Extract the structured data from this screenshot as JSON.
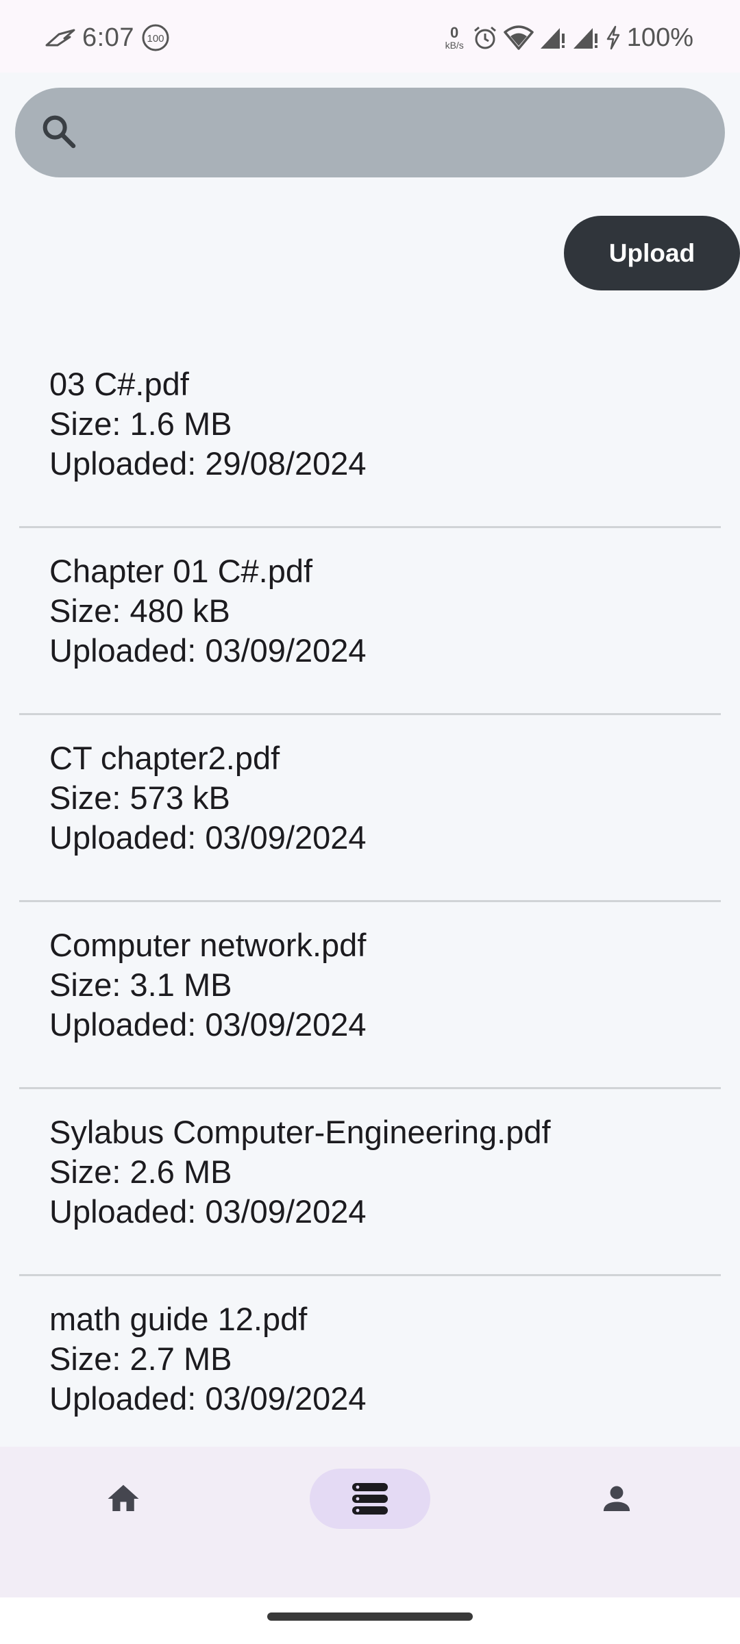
{
  "status_bar": {
    "time": "6:07",
    "speed_value": "0",
    "speed_unit": "kB/s",
    "battery": "100%",
    "notification_badge": "100"
  },
  "search": {
    "placeholder": "",
    "value": ""
  },
  "actions": {
    "upload_label": "Upload"
  },
  "files": [
    {
      "name": "03 C#.pdf",
      "size": "Size: 1.6 MB",
      "uploaded": "Uploaded: 29/08/2024"
    },
    {
      "name": "Chapter 01 C#.pdf",
      "size": "Size: 480 kB",
      "uploaded": "Uploaded: 03/09/2024"
    },
    {
      "name": "CT chapter2.pdf",
      "size": "Size: 573 kB",
      "uploaded": "Uploaded: 03/09/2024"
    },
    {
      "name": "Computer network.pdf",
      "size": "Size: 3.1 MB",
      "uploaded": "Uploaded: 03/09/2024"
    },
    {
      "name": "Sylabus Computer-Engineering.pdf",
      "size": "Size: 2.6 MB",
      "uploaded": "Uploaded: 03/09/2024"
    },
    {
      "name": "math guide 12.pdf",
      "size": "Size: 2.7 MB",
      "uploaded": "Uploaded: 03/09/2024"
    }
  ],
  "bottom_nav": {
    "items": [
      {
        "icon": "home-icon",
        "active": false
      },
      {
        "icon": "list-icon",
        "active": true
      },
      {
        "icon": "person-icon",
        "active": false
      }
    ]
  },
  "colors": {
    "search_bg": "#A9B1B8",
    "upload_bg": "#30353B",
    "nav_bg": "#F2EDF6",
    "nav_active": "#E4DAF4"
  }
}
